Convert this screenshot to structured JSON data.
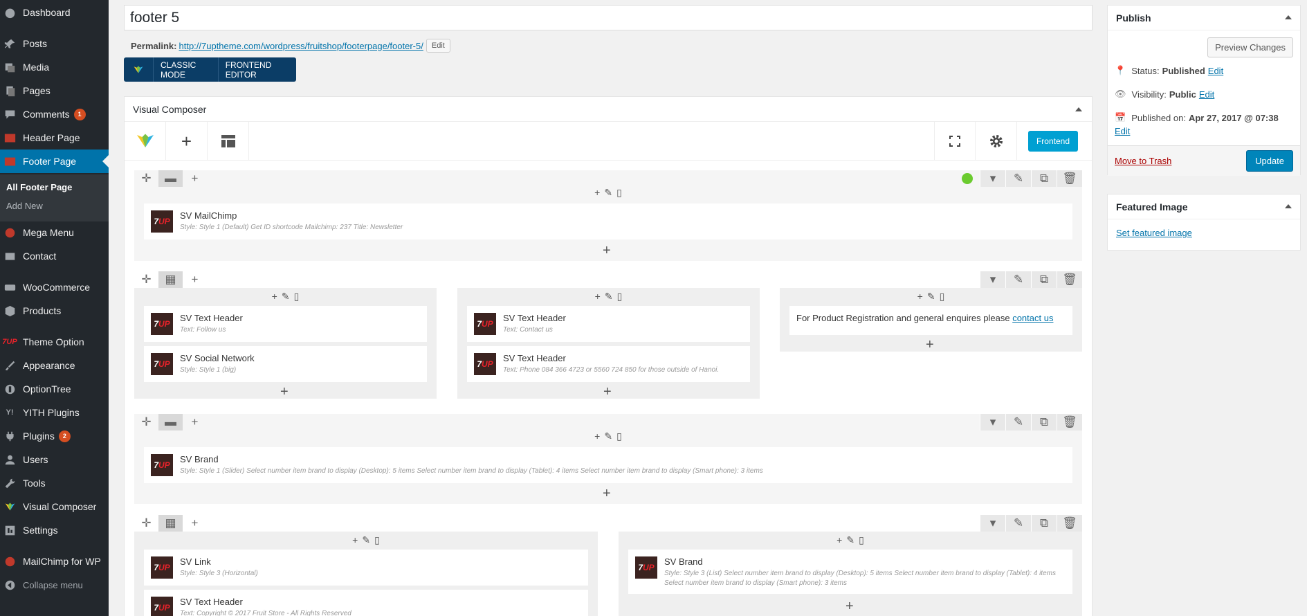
{
  "sidebar": {
    "dashboard": "Dashboard",
    "posts": "Posts",
    "media": "Media",
    "pages": "Pages",
    "comments": "Comments",
    "comments_badge": "1",
    "header_page": "Header Page",
    "footer_page": "Footer Page",
    "all_footer_page": "All Footer Page",
    "add_new": "Add New",
    "mega_menu": "Mega Menu",
    "contact": "Contact",
    "woocommerce": "WooCommerce",
    "products": "Products",
    "theme_option": "Theme Option",
    "appearance": "Appearance",
    "optiontree": "OptionTree",
    "yith": "YITH Plugins",
    "plugins": "Plugins",
    "plugins_badge": "2",
    "users": "Users",
    "tools": "Tools",
    "visual_composer": "Visual Composer",
    "settings": "Settings",
    "mailchimp": "MailChimp for WP",
    "collapse": "Collapse menu"
  },
  "post": {
    "title": "footer 5",
    "permalink_label": "Permalink:",
    "permalink_url": "http://7uptheme.com/wordpress/fruitshop/footerpage/footer-5/",
    "edit_label": "Edit",
    "classic_mode": "CLASSIC MODE",
    "frontend_editor": "FRONTEND EDITOR"
  },
  "vc": {
    "heading": "Visual Composer",
    "frontend_btn": "Frontend",
    "logo_text": "7",
    "logo_text2": "UP",
    "elements": {
      "mailchimp_title": "SV MailChimp",
      "mailchimp_desc": "Style: Style 1 (Default)  Get ID shortcode Mailchimp: 237  Title: Newsletter",
      "text_header1_title": "SV Text Header",
      "text_header1_desc": "Text: Follow us",
      "social_title": "SV Social Network",
      "social_desc": "Style: Style 1 (big)",
      "text_header2_title": "SV Text Header",
      "text_header2_desc": "Text: Contact us",
      "text_header3_title": "SV Text Header",
      "text_header3_desc": "Text: Phone 084 366 4723 or 5560 724 850 for those outside of Hanoi.",
      "contact_text": "For Product Registration and general enquires please",
      "contact_link": "contact us",
      "brand1_title": "SV Brand",
      "brand1_desc": "Style: Style 1 (Slider)  Select number item brand to display (Desktop): 5 items  Select number item brand to display (Tablet): 4 items  Select number item brand to display (Smart phone): 3 items",
      "link_title": "SV Link",
      "link_desc": "Style: Style 3 (Horizontal)",
      "text_header4_title": "SV Text Header",
      "text_header4_desc": "Text: Copyright © 2017 Fruit Store - All Rights Reserved",
      "brand2_title": "SV Brand",
      "brand2_desc": "Style: Style 3 (List)  Select number item brand to display (Desktop): 5 items  Select number item brand to display (Tablet): 4 items  Select number item brand to display (Smart phone): 3 items"
    }
  },
  "publish": {
    "heading": "Publish",
    "preview": "Preview Changes",
    "status_label": "Status:",
    "status_value": "Published",
    "visibility_label": "Visibility:",
    "visibility_value": "Public",
    "published_label": "Published on:",
    "published_value": "Apr 27, 2017 @ 07:38",
    "edit": "Edit",
    "trash": "Move to Trash",
    "update": "Update"
  },
  "featured": {
    "heading": "Featured Image",
    "set": "Set featured image"
  },
  "colors": {
    "accent": "#0073aa",
    "sidebar": "#23282d",
    "vcbar": "#0b3d66",
    "frontend": "#00a0d2"
  }
}
